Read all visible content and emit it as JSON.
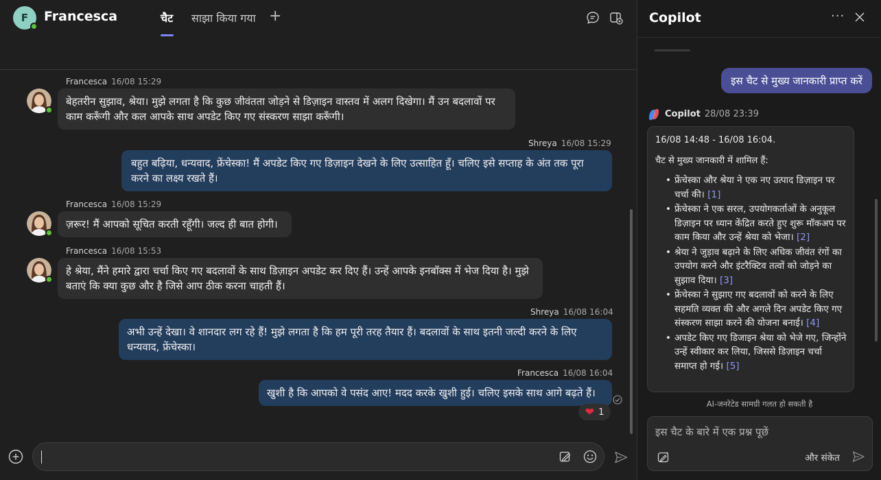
{
  "chat": {
    "contact_initial": "F",
    "contact_name": "Francesca",
    "tabs": {
      "chat": "चैट",
      "shared": "साझा किया गया",
      "add": "+"
    },
    "messages": [
      {
        "sender": "Francesca",
        "time": "16/08 15:29",
        "text": "बेहतरीन सुझाव, श्रेया। मुझे लगता है कि कुछ जीवंतता जोड़ने से डिज़ाइन वास्तव में अलग दिखेगा। मैं उन बदलावों पर काम करूँगी और कल आपके साथ अपडेट किए गए संस्करण साझा करूँगी।"
      },
      {
        "sender": "Shreya",
        "time": "16/08 15:29",
        "text": "बहुत बढ़िया, धन्यवाद, फ्रेंचेस्का! मैं अपडेट किए गए डिज़ाइन देखने के लिए उत्साहित हूँ। चलिए इसे सप्ताह के अंत तक पूरा करने का लक्ष्य रखते हैं।"
      },
      {
        "sender": "Francesca",
        "time": "16/08 15:29",
        "text": "ज़रूर! मैं आपको सूचित करती रहूँगी। जल्द ही बात होगी।"
      },
      {
        "sender": "Francesca",
        "time": "16/08 15:53",
        "text": "हे श्रेया, मैंने हमारे द्वारा चर्चा किए गए बदलावों के साथ डिज़ाइन अपडेट कर दिए हैं। उन्हें आपके इनबॉक्स में भेज दिया है। मुझे बताएं कि क्या कुछ और है जिसे आप ठीक करना चाहती हैं।"
      },
      {
        "sender": "Shreya",
        "time": "16/08 16:04",
        "text": "अभी उन्हें देखा। वे शानदार लग रहे हैं! मुझे लगता है कि हम पूरी तरह तैयार हैं। बदलावों के साथ इतनी जल्दी करने के लिए धन्यवाद, फ्रेंचेस्का।"
      },
      {
        "sender": "Francesca",
        "time": "16/08 16:04",
        "text": "खुशी है कि आपको वे पसंद आए! मदद करके खुशी हुई। चलिए इसके साथ आगे बढ़ते हैं।"
      }
    ],
    "reaction": {
      "emoji": "❤",
      "count": "1"
    },
    "compose": {
      "value": "",
      "placeholder": ""
    }
  },
  "copilot": {
    "title": "Copilot",
    "more": "···",
    "user_prompt": "इस चैट से मुख्य जानकारी प्राप्त करें",
    "response_sender": "Copilot",
    "response_time": "28/08 23:39",
    "answer": {
      "range": "16/08 14:48 - 16/08 16:04.",
      "intro": "चैट से मुख्य जानकारी में शामिल हैं:",
      "points": [
        {
          "text": "फ्रेंचेस्का और श्रेया ने एक नए उत्पाद डिज़ाइन पर चर्चा की।",
          "cite": "[1]"
        },
        {
          "text": "फ्रेंचेस्का ने एक सरल, उपयोगकर्ताओं के अनुकूल डिज़ाइन पर ध्यान केंद्रित करते हुए शुरू मॉकअप पर काम किया और उन्हें श्रेया को भेजा।",
          "cite": "[2]"
        },
        {
          "text": "श्रेया ने जुड़ाव बढ़ाने के लिए अधिक जीवंत रंगों का उपयोग करने और इंटरैक्टिव तत्वों को जोड़ने का सुझाव दिया।",
          "cite": "[3]"
        },
        {
          "text": "फ्रेंचेस्का ने सुझाए गए बदलावों को करने के लिए सहमति व्यक्त की और अगले दिन अपडेट किए गए संस्करण साझा करने की योजना बनाई।",
          "cite": "[4]"
        },
        {
          "text": "अपडेट किए गए डिजाइन श्रेया को भेजे गए, जिन्होंने उन्हें स्वीकार कर लिया, जिससे डिज़ाइन चर्चा समाप्त हो गई।",
          "cite": "[5]"
        }
      ]
    },
    "disclaimer": "AI-जनरेटेड सामग्री गलत हो सकती है",
    "ask": {
      "placeholder": "इस चैट के बारे में एक प्रश्न पूछें",
      "value": ""
    },
    "more_prompts": "और संकेत"
  },
  "colors": {
    "accent": "#7f85f5",
    "outgoing_bubble": "#233d5d",
    "incoming_bubble": "#2f2f2f",
    "user_prompt_bubble": "#4a4f95",
    "presence": "#5fc13a"
  },
  "icons": [
    "chat-bubble-icon",
    "copilot-toggle-icon",
    "add-icon",
    "format-icon",
    "emoji-icon",
    "send-icon",
    "more-icon",
    "close-icon",
    "copilot-logo-icon",
    "prompts-icon",
    "seen-icon",
    "heart-icon"
  ]
}
